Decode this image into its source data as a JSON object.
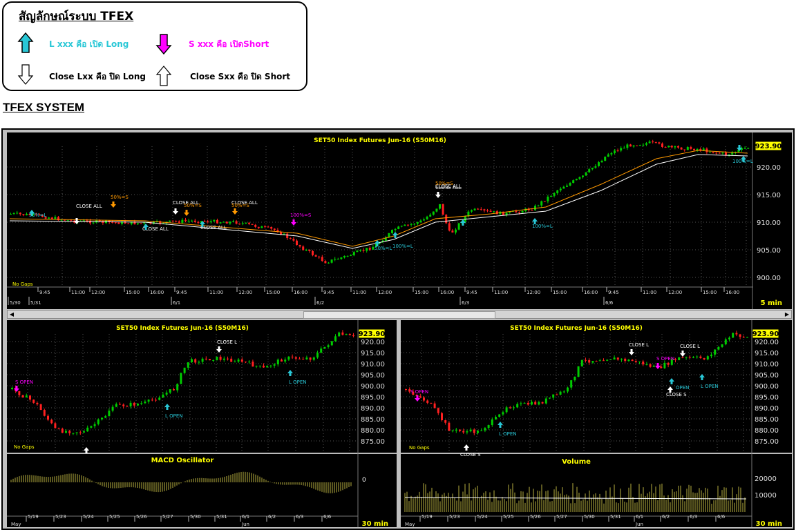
{
  "legend": {
    "title": "สัญลักษณ์ระบบ TFEX",
    "long_open": "L xxx คือ เปิด Long",
    "short_open": "S xxx คือ เปิดShort",
    "long_close": "Close Lxx คือ ปิด Long",
    "short_close": "Close Sxx คือ ปิด Short"
  },
  "system_title": "TFEX SYSTEM",
  "colors": {
    "up": "#00cc00",
    "down": "#ff2020",
    "cyan": "#29c7d6",
    "magenta": "#ff00ff",
    "orange": "#ff9900",
    "price_tag": "#ffff00",
    "grid": "#555555"
  },
  "top_chart": {
    "title": "SET50  Index  Futures  Jun-16   (S50M16)",
    "last_price": "923.90",
    "y_ticks": [
      "920.00",
      "915.00",
      "910.00",
      "905.00",
      "900.00"
    ],
    "x_times": [
      "9:45",
      "11:00",
      "12:00",
      "15:00",
      "16:00",
      "9:45",
      "11:00",
      "12:00",
      "15:00",
      "16:00",
      "9:45",
      "11:00",
      "12:00",
      "15:00",
      "16:00",
      "9:45",
      "11:00",
      "12:00",
      "15:00",
      "16:00",
      "9:45",
      "11:00",
      "12:00",
      "15:00",
      "16:00"
    ],
    "x_dates": [
      "5/30",
      "5/31",
      "6/1",
      "6/2",
      "6/3",
      "6/6"
    ],
    "timeframe": "5 min",
    "no_gaps": "No Gaps",
    "annotations": [
      "CLOSE ALL",
      "50%=S",
      "CLOSE ALL",
      "50%=S",
      "CLOSE ALL",
      "50%=S",
      "CLOSE ALL",
      "CLOSE ALL",
      "CLOSE ALL",
      "100%=S",
      "50%=S",
      "CLOSE ALL",
      "50%=L",
      "100%=L",
      "50%=L",
      "100%=L",
      "100%=L"
    ]
  },
  "left_chart": {
    "title": "SET50  Index  Futures  Jun-16   (S50M16)",
    "last_price": "923.90",
    "y_ticks": [
      "920.00",
      "915.00",
      "910.00",
      "905.00",
      "900.00",
      "895.00",
      "890.00",
      "885.00",
      "880.00",
      "875.00"
    ],
    "labels": {
      "s_open": "S  OPEN",
      "l_open1": "L  OPEN",
      "close_l": "CLOSE  L",
      "l_open2": "L  OPEN"
    },
    "no_gaps": "No Gaps",
    "indicator_title": "MACD  Oscillator",
    "indicator_zero": "0",
    "x_dates": [
      "5/19",
      "5/23",
      "5/24",
      "5/25",
      "5/26",
      "5/27",
      "5/30",
      "5/31",
      "6/1",
      "6/2",
      "6/3",
      "6/6"
    ],
    "months": [
      "May",
      "Jun"
    ],
    "timeframe": "30  min"
  },
  "right_chart": {
    "title": "SET50  Index  Futures  Jun-16   (S50M16)",
    "last_price": "923.90",
    "y_ticks": [
      "920.00",
      "915.00",
      "910.00",
      "905.00",
      "900.00",
      "895.00",
      "890.00",
      "885.00",
      "880.00",
      "875.00"
    ],
    "labels": {
      "s_open1": "S  OPEN",
      "l_open1": "L  OPEN",
      "close_s1": "CLOSE  S",
      "close_l1": "CLOSE  L",
      "s_open2": "S  OPEN",
      "close_l2": "CLOSE  L",
      "open": "OPEN",
      "close_s2": "CLOSE  S",
      "l_open2": "L  OPEN"
    },
    "no_gaps": "No Gaps",
    "indicator_title": "Volume",
    "vol_ticks": [
      "20000",
      "10000"
    ],
    "x_dates": [
      "5/19",
      "5/23",
      "5/24",
      "5/25",
      "5/26",
      "5/27",
      "5/30",
      "5/31",
      "6/1",
      "6/2",
      "6/3",
      "6/6"
    ],
    "months": [
      "May",
      "Jun"
    ],
    "timeframe": "30  min"
  }
}
